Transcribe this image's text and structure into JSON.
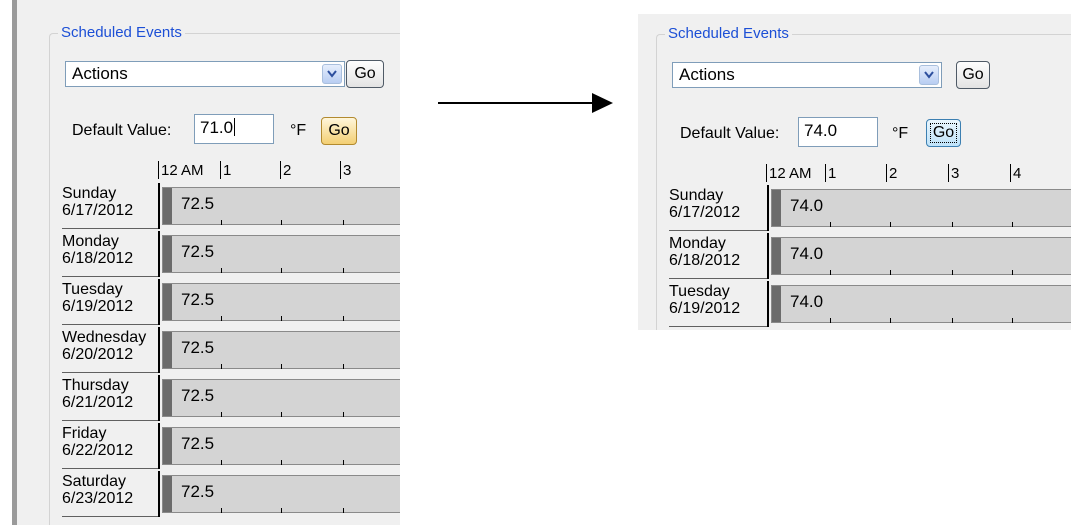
{
  "left": {
    "group_title": "Scheduled Events",
    "actions_value": "Actions",
    "go_label": "Go",
    "default_label": "Default Value:",
    "default_value": "71.0",
    "unit": "°F",
    "timescale": [
      "12 AM",
      "1",
      "2",
      "3"
    ],
    "days": [
      {
        "day": "Sunday",
        "date": "6/17/2012",
        "value": "72.5"
      },
      {
        "day": "Monday",
        "date": "6/18/2012",
        "value": "72.5"
      },
      {
        "day": "Tuesday",
        "date": "6/19/2012",
        "value": "72.5"
      },
      {
        "day": "Wednesday",
        "date": "6/20/2012",
        "value": "72.5"
      },
      {
        "day": "Thursday",
        "date": "6/21/2012",
        "value": "72.5"
      },
      {
        "day": "Friday",
        "date": "6/22/2012",
        "value": "72.5"
      },
      {
        "day": "Saturday",
        "date": "6/23/2012",
        "value": "72.5"
      }
    ]
  },
  "right": {
    "group_title": "Scheduled Events",
    "actions_value": "Actions",
    "go_label": "Go",
    "default_label": "Default Value:",
    "default_value": "74.0",
    "unit": "°F",
    "timescale": [
      "12 AM",
      "1",
      "2",
      "3",
      "4"
    ],
    "days": [
      {
        "day": "Sunday",
        "date": "6/17/2012",
        "value": "74.0"
      },
      {
        "day": "Monday",
        "date": "6/18/2012",
        "value": "74.0"
      },
      {
        "day": "Tuesday",
        "date": "6/19/2012",
        "value": "74.0"
      }
    ]
  },
  "icons": {
    "dropdown": "chevron-down-icon",
    "arrow": "right-arrow-icon"
  },
  "colors": {
    "legend_text": "#1c4fd6",
    "go_hot": "#f3cf73",
    "go_focused": "#bfe3fa",
    "event_bar": "#d4d4d4"
  }
}
